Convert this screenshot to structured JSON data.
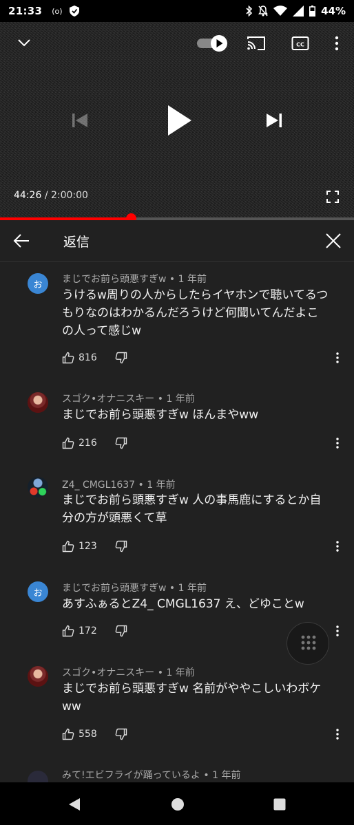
{
  "status_bar": {
    "time": "21:33",
    "left_icons": [
      "radio-icon",
      "shield-icon"
    ],
    "right_icons": [
      "bluetooth-icon",
      "bell-off-icon",
      "wifi-icon",
      "signal-icon",
      "battery-icon"
    ],
    "battery_percent": "44%"
  },
  "player": {
    "current_time": "44:26",
    "separator": "/",
    "duration": "2:00:00",
    "progress_fraction": 0.37,
    "autoplay_on": true,
    "controls": [
      "collapse-icon",
      "autoplay-toggle",
      "cast-icon",
      "captions-icon",
      "more-vert-icon",
      "previous-icon",
      "play-icon",
      "next-icon",
      "fullscreen-icon"
    ]
  },
  "panel": {
    "title": "返信",
    "back_icon": "arrow-left-icon",
    "close_icon": "close-icon"
  },
  "comments": [
    {
      "avatar_type": "letter",
      "avatar_letter": "お",
      "author": "まじでお前ら頭悪すぎw",
      "age": "1 年前",
      "lines": [
        "うけるw周りの人からしたらイヤホンで聴いてるつ",
        "もりなのはわかるんだろうけど何聞いてんだよこ",
        "の人って感じw"
      ],
      "likes": "816"
    },
    {
      "avatar_type": "photo",
      "author": "スゴク•オナニスキー",
      "age": "1 年前",
      "lines": [
        "まじでお前ら頭悪すぎw ほんまやww"
      ],
      "likes": "216"
    },
    {
      "avatar_type": "z4",
      "author": "Z4_ CMGL1637",
      "age": "1 年前",
      "lines": [
        "まじでお前ら頭悪すぎw 人の事馬鹿にするとか自",
        "分の方が頭悪くて草"
      ],
      "likes": "123"
    },
    {
      "avatar_type": "letter",
      "avatar_letter": "お",
      "author": "まじでお前ら頭悪すぎw",
      "age": "1 年前",
      "lines": [
        "あすふぁるとZ4_ CMGL1637 え、どゆことw"
      ],
      "likes": "172"
    },
    {
      "avatar_type": "photo",
      "author": "スゴク•オナニスキー",
      "age": "1 年前",
      "lines": [
        "まじでお前ら頭悪すぎw 名前がややこしいわボケ",
        "ww"
      ],
      "likes": "558"
    },
    {
      "avatar_type": "partial",
      "author": "みて!エビフライが踊っているよ",
      "age": "1 年前",
      "lines": [],
      "likes": ""
    }
  ],
  "fab_icon": "dialpad-icon",
  "nav_bar": [
    "back-triangle-icon",
    "home-circle-icon",
    "recents-square-icon"
  ]
}
